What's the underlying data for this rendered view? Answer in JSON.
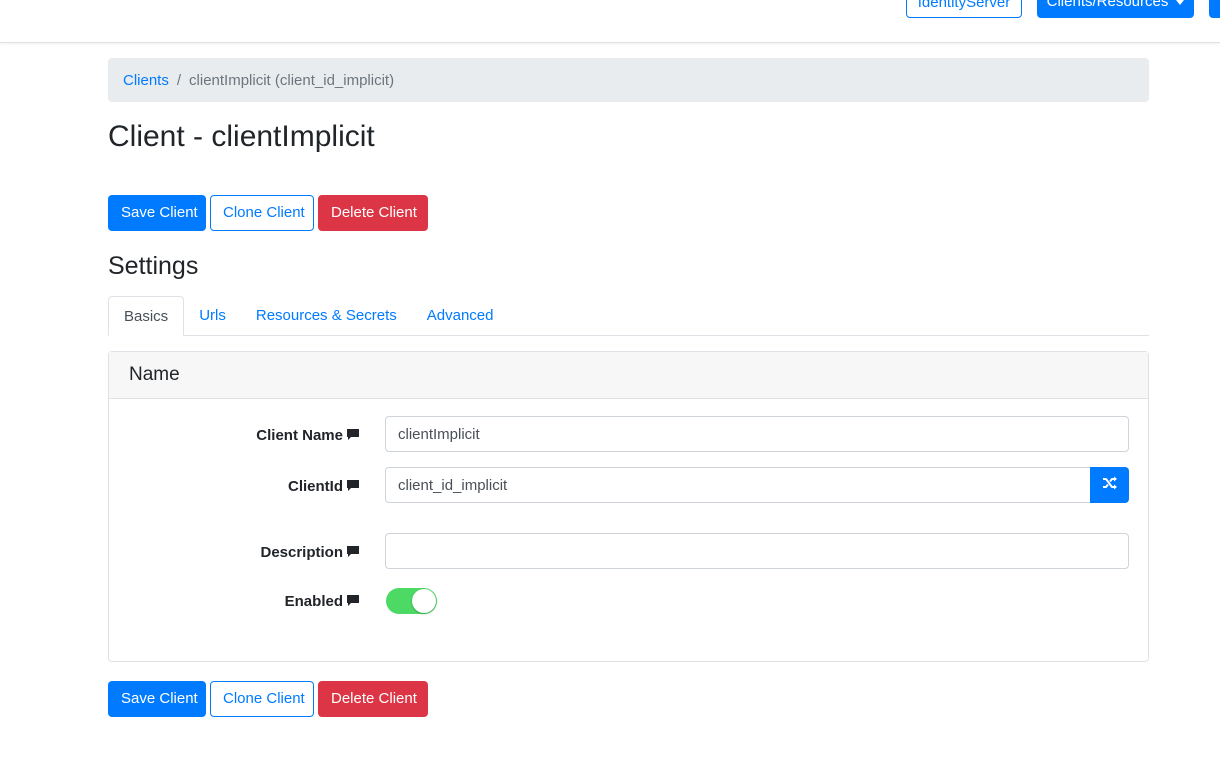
{
  "navbar": {
    "identity_label": "IdentityServer",
    "clients_label": "Clients/Resources"
  },
  "breadcrumb": {
    "clients_link": "Clients",
    "separator": "/",
    "current": "clientImplicit (client_id_implicit)"
  },
  "page_title": "Client - clientImplicit",
  "actions": {
    "save_label": "Save Client",
    "clone_label": "Clone Client",
    "delete_label": "Delete Client"
  },
  "settings_title": "Settings",
  "tabs": [
    {
      "label": "Basics",
      "active": true
    },
    {
      "label": "Urls",
      "active": false
    },
    {
      "label": "Resources & Secrets",
      "active": false
    },
    {
      "label": "Advanced",
      "active": false
    }
  ],
  "card": {
    "title": "Name",
    "fields": {
      "client_name": {
        "label": "Client Name",
        "value": "clientImplicit"
      },
      "client_id": {
        "label": "ClientId",
        "value": "client_id_implicit"
      },
      "description": {
        "label": "Description",
        "value": ""
      },
      "enabled": {
        "label": "Enabled",
        "value": true
      }
    }
  },
  "icons": {
    "label_help": "comment-icon",
    "generate_id": "random-shuffle-icon"
  },
  "colors": {
    "primary": "#007bff",
    "danger": "#dc3545",
    "toggle_on": "#4cd964",
    "breadcrumb_bg": "#e9ecef"
  }
}
